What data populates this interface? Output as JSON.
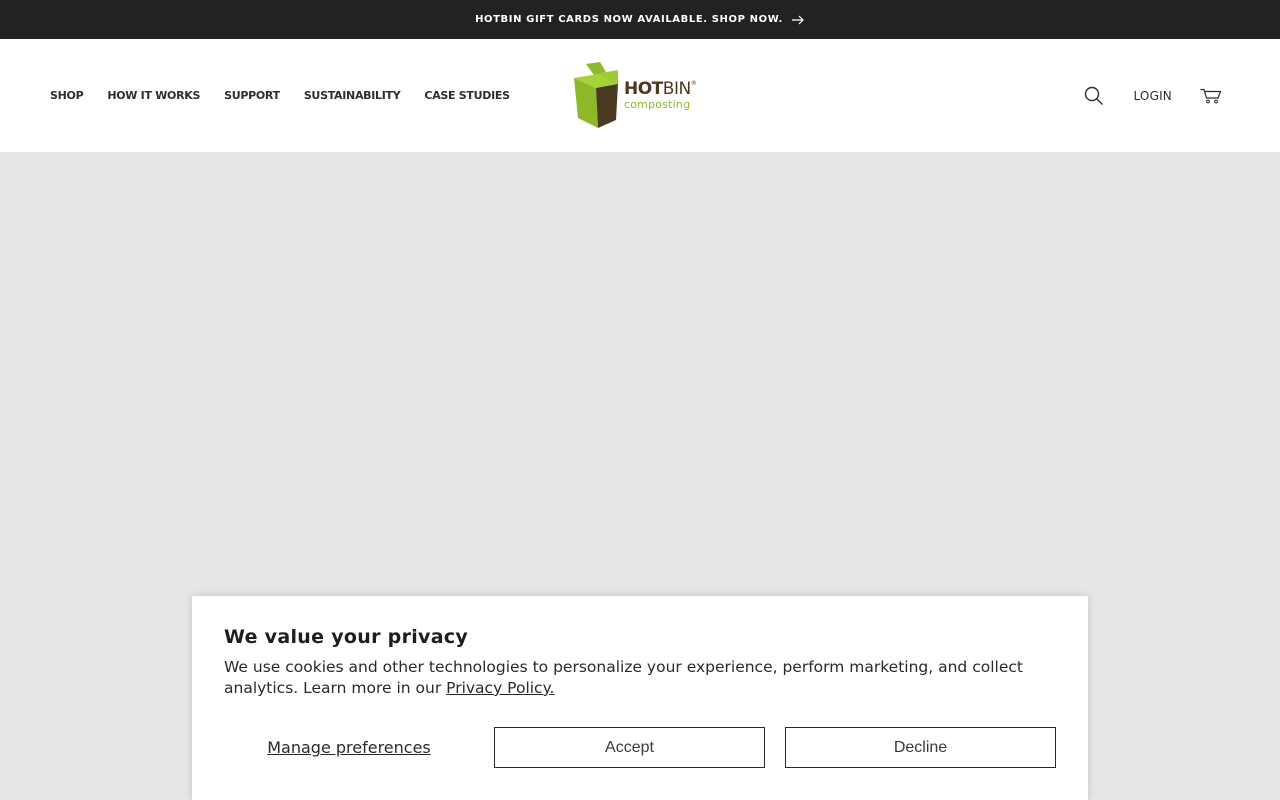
{
  "announcement": {
    "text": "HOTBIN GIFT CARDS NOW AVAILABLE. SHOP NOW."
  },
  "nav": {
    "items": [
      {
        "label": "SHOP"
      },
      {
        "label": "HOW IT WORKS"
      },
      {
        "label": "SUPPORT"
      },
      {
        "label": "SUSTAINABILITY"
      },
      {
        "label": "CASE STUDIES"
      }
    ]
  },
  "logo": {
    "hot": "HOT",
    "bin": "BIN",
    "reg": "®",
    "sub": "composting"
  },
  "header": {
    "login_label": "LOGIN"
  },
  "colors": {
    "announcement_bg": "#222222",
    "logo_green": "#8cb82a",
    "logo_brown": "#4a3a22",
    "hero_bg": "#e6e6e6"
  },
  "cookie": {
    "title": "We value your privacy",
    "body": "We use cookies and other technologies to personalize your experience, perform marketing, and collect analytics. Learn more in our ",
    "policy_link": "Privacy Policy.",
    "manage_label": "Manage preferences",
    "accept_label": "Accept",
    "decline_label": "Decline"
  }
}
